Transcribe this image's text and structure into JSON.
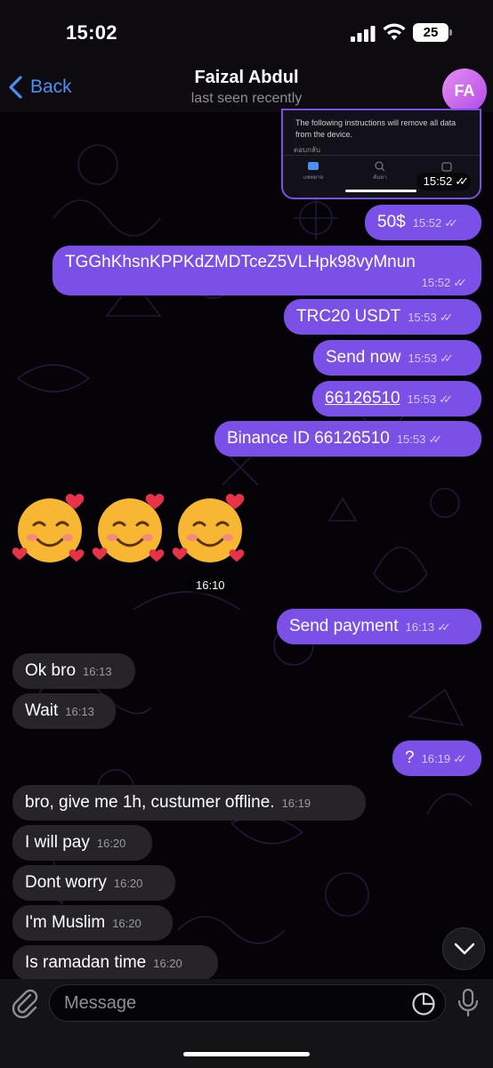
{
  "status_bar": {
    "time": "15:02",
    "battery": "25"
  },
  "header": {
    "back_label": "Back",
    "contact_name": "Faizal Abdul",
    "contact_status": "last seen recently",
    "avatar_initials": "FA"
  },
  "image_preview": {
    "text": "The following instructions will remove all data from the device.",
    "reply_text": "ตอบกลับ",
    "tabs": [
      "แชทยาส",
      "ค้นหา",
      ""
    ],
    "time": "15:52"
  },
  "outgoing_top": [
    {
      "text": "50$",
      "time": "15:52"
    },
    {
      "text": "TGGhKhsnKPPKdZMDTceZ5VLHpk98vyMnun",
      "time": "15:52"
    },
    {
      "text": "TRC20 USDT",
      "time": "15:53"
    },
    {
      "text": "Send now",
      "time": "15:53"
    },
    {
      "text": "66126510",
      "time": "15:53"
    },
    {
      "text": "Binance ID 66126510",
      "time": "15:53"
    }
  ],
  "emoji_message": {
    "time": "16:10"
  },
  "outgoing_mid": {
    "text": "Send payment",
    "time": "16:13"
  },
  "incoming_1": [
    {
      "text": "Ok bro",
      "time": "16:13"
    },
    {
      "text": "Wait",
      "time": "16:13"
    }
  ],
  "outgoing_question": {
    "text": "?",
    "time": "16:19"
  },
  "incoming_2": [
    {
      "text": "bro, give me 1h, custumer offline.",
      "time": "16:19"
    },
    {
      "text": "I will pay",
      "time": "16:20"
    },
    {
      "text": "Dont worry",
      "time": "16:20"
    },
    {
      "text": "I'm Muslim",
      "time": "16:20"
    },
    {
      "text": "Is ramadan time",
      "time": "16:20"
    }
  ],
  "composer": {
    "placeholder": "Message"
  },
  "colors": {
    "outgoing": "#7b50e6",
    "incoming": "#262428",
    "accent": "#4a90f0"
  },
  "icons": [
    "chevron-left-icon",
    "signal-icon",
    "wifi-icon",
    "attach-icon",
    "sticker-icon",
    "mic-icon",
    "chevron-down-icon"
  ]
}
